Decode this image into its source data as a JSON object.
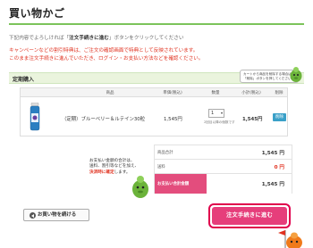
{
  "page": {
    "title": "買い物かご",
    "instruction_prefix": "下記内容でよろしければ「",
    "instruction_emphasis": "注文手続きに進む",
    "instruction_suffix": "」ボタンをクリックしてください",
    "notice_line1": "キャンペーンなどの割引特典は、ご注文の確認画面で特典として反映されています。",
    "notice_line2": "このまま注文手続きに進んでいただき、ログイン・お支払い方法などを確認ください。"
  },
  "section": {
    "label": "定期購入",
    "mascot_note": "カートから商品を削除する場合は、「削除」ボタンを押してください。"
  },
  "table": {
    "headers": [
      "商品",
      "単価(税込)",
      "数量",
      "小計(税込)",
      "削除"
    ],
    "row": {
      "name": "（定期）ブルーベリー＆ルテイン30粒",
      "unit_price": "1,545円",
      "qty": "1",
      "qty_note": "2回目以降の個数です",
      "subtotal": "1,545円",
      "delete_label": "削除"
    }
  },
  "summary": {
    "rows": [
      {
        "label": "商品合計",
        "value": "1,545 円"
      },
      {
        "label": "送料",
        "value": "0 円"
      },
      {
        "label": "お支払い合計金額",
        "value": "1,545 円"
      }
    ]
  },
  "bubble": {
    "line1": "お支払い金額の合計は、",
    "line2": "送料、割引等などを加え、",
    "line3_red": "決済時に確定",
    "line3_rest": "します。"
  },
  "buttons": {
    "continue": "お買い物を続ける",
    "checkout": "注文手続きに進む"
  },
  "colors": {
    "accent_green": "#7cc35a",
    "checkout_pink": "#e63e7b",
    "outline_red": "#e0004c",
    "delete_blue": "#3aa0c8",
    "notice_red": "#e0311f"
  }
}
